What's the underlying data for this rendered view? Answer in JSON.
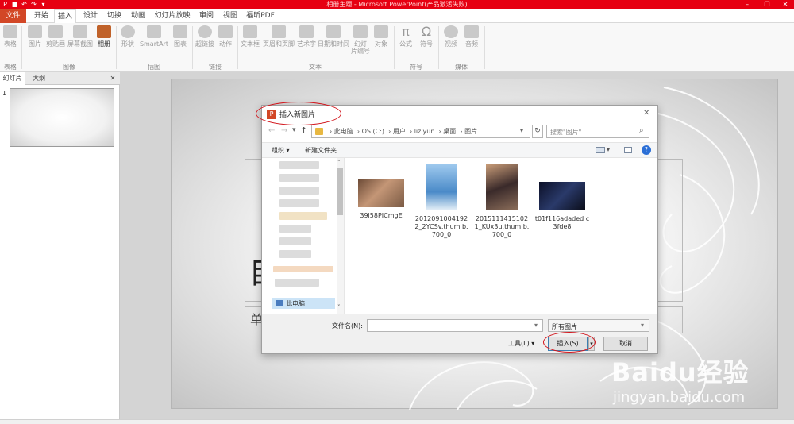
{
  "window": {
    "title": "相册主题 - Microsoft PowerPoint(产品激活失败)"
  },
  "qat": {
    "icons": [
      "powerpoint-icon",
      "save-icon",
      "undo-icon",
      "redo-icon",
      "customize-icon"
    ]
  },
  "tabs": [
    {
      "label": "文件"
    },
    {
      "label": "开始"
    },
    {
      "label": "插入"
    },
    {
      "label": "设计"
    },
    {
      "label": "切换"
    },
    {
      "label": "动画"
    },
    {
      "label": "幻灯片放映"
    },
    {
      "label": "审阅"
    },
    {
      "label": "视图"
    },
    {
      "label": "福昕PDF"
    }
  ],
  "ribbon": {
    "table": "表格",
    "image": "图片",
    "clipart": "剪贴画",
    "screenshot": "屏幕截图",
    "album": "相册",
    "shapes": "形状",
    "smartart": "SmartArt",
    "chart": "图表",
    "hyperlink": "超链接",
    "action": "动作",
    "textbox": "文本框",
    "header": "页眉和页脚",
    "wordart": "艺术字",
    "datetime": "日期和时间",
    "slidenum1": "幻灯",
    "slidenum2": "片编号",
    "object": "对象",
    "formula": "公式",
    "symbol": "符号",
    "video": "视频",
    "audio": "音频",
    "group_table": "表格",
    "group_image": "图像",
    "group_illustration": "插图",
    "group_link": "链接",
    "group_text": "文本",
    "group_symbol": "符号",
    "group_media": "媒体"
  },
  "leftpane": {
    "tab_slides": "幻灯片",
    "tab_outline": "大纲",
    "slide_num": "1",
    "close": "✕"
  },
  "slide": {
    "title_char": "自",
    "sub_char": "单"
  },
  "dialog": {
    "title": "插入新图片",
    "close": "✕",
    "path": [
      "此电脑",
      "OS (C:)",
      "用户",
      "liziyun",
      "桌面",
      "图片"
    ],
    "search_placeholder": "搜索\"图片\"",
    "organize": "组织 ▾",
    "new_folder": "新建文件夹",
    "help": "?",
    "nav_item": "此电脑",
    "files": [
      {
        "name": "39l58PICmgE"
      },
      {
        "name": "2012091004192 2_2YCSv.thum b.700_0"
      },
      {
        "name": "2015111415102 1_KUx3u.thum b.700_0"
      },
      {
        "name": "t01f116adaded c3fde8"
      }
    ],
    "filename_label": "文件名(N):",
    "filename_value": "",
    "filetype": "所有图片",
    "tools": "工具(L)",
    "insert": "插入(S)",
    "cancel": "取消"
  },
  "watermark": {
    "brand": "Baidu经验",
    "url": "jingyan.baidu.com"
  },
  "colors": {
    "file_tab": "#d24726",
    "titlebar": "#e60012",
    "annotation": "#d2141b",
    "accent_blue": "#2b579a"
  }
}
